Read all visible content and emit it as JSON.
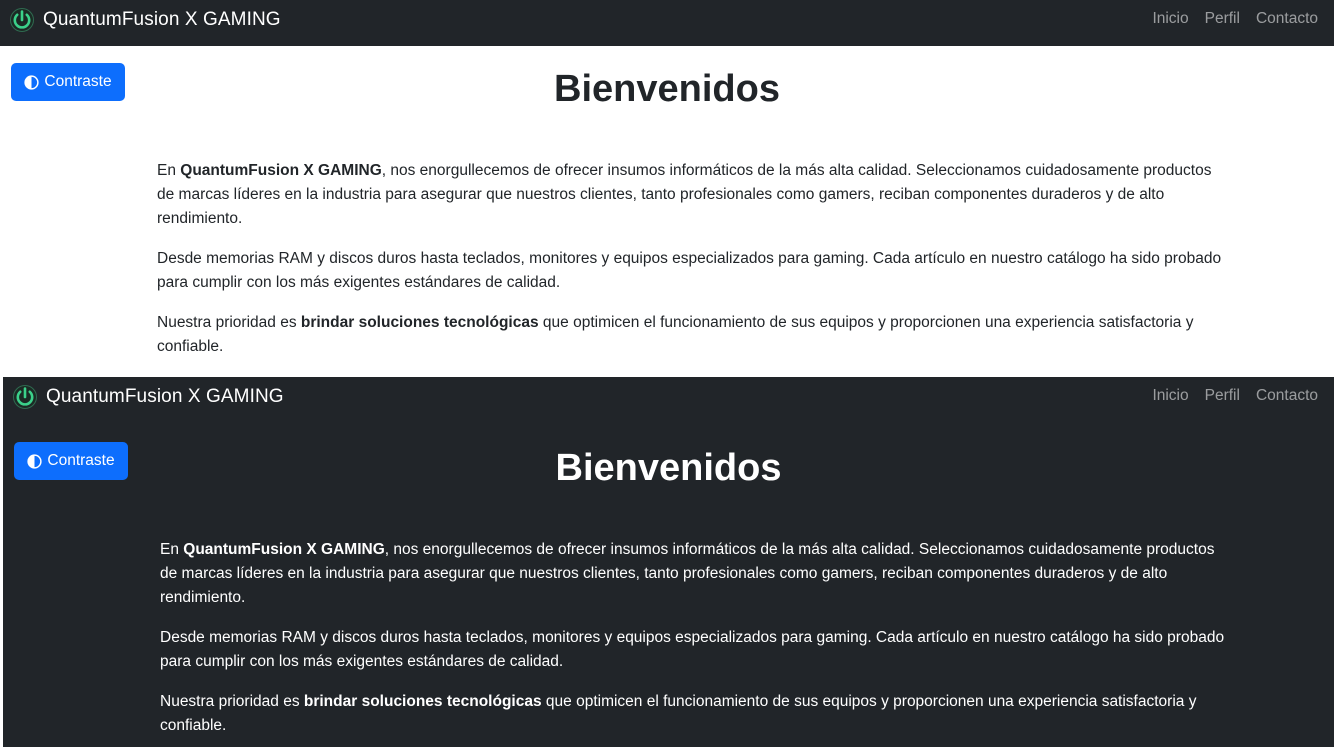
{
  "brand": {
    "name": "QuantumFusion X GAMING",
    "logo_icon": "power-icon"
  },
  "nav": {
    "items": [
      {
        "label": "Inicio"
      },
      {
        "label": "Perfil"
      },
      {
        "label": "Contacto"
      }
    ]
  },
  "contrast_button": {
    "label": "Contraste",
    "icon": "contrast-half-circle-icon"
  },
  "main": {
    "title": "Bienvenidos",
    "paragraphs": [
      {
        "before": "En ",
        "bold": "QuantumFusion X GAMING",
        "after": ", nos enorgullecemos de ofrecer insumos informáticos de la más alta calidad. Seleccionamos cuidadosamente productos de marcas líderes en la industria para asegurar que nuestros clientes, tanto profesionales como gamers, reciban componentes duraderos y de alto rendimiento."
      },
      {
        "text": "Desde memorias RAM y discos duros hasta teclados, monitores y equipos especializados para gaming. Cada artículo en nuestro catálogo ha sido probado para cumplir con los más exigentes estándares de calidad."
      },
      {
        "before": "Nuestra prioridad es ",
        "bold": "brindar soluciones tecnológicas",
        "after": " que optimicen el funcionamiento de sus equipos y proporcionen una experiencia satisfactoria y confiable."
      }
    ]
  },
  "colors": {
    "navbar_bg": "#212529",
    "dark_bg": "#212529",
    "light_bg": "#ffffff",
    "primary": "#0d6efd",
    "nav_link": "rgba(255,255,255,0.55)",
    "logo_accent": "#22a36b"
  },
  "modes": [
    "light",
    "dark"
  ]
}
